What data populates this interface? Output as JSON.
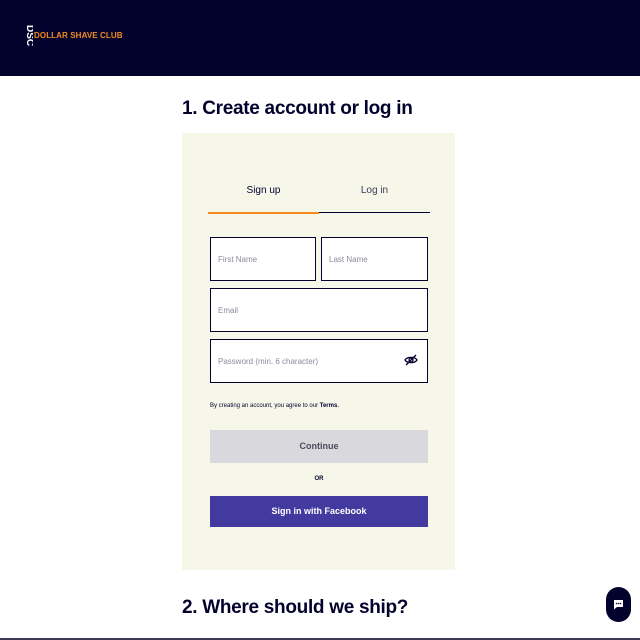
{
  "header": {
    "logo_mark": "DSC",
    "brand_name": "DOLLAR SHAVE CLUB"
  },
  "steps": {
    "step1_title": "1. Create account or log in",
    "step2_title": "2. Where should we ship?"
  },
  "tabs": {
    "signup_label": "Sign up",
    "login_label": "Log in",
    "active": "signup"
  },
  "form": {
    "first_name_placeholder": "First Name",
    "last_name_placeholder": "Last Name",
    "email_placeholder": "Email",
    "password_placeholder": "Password (min. 6 character)",
    "first_name_value": "",
    "last_name_value": "",
    "email_value": "",
    "password_value": ""
  },
  "terms": {
    "prefix": "By creating an account, you agree to our ",
    "link_label": "Terms",
    "suffix": "."
  },
  "buttons": {
    "continue_label": "Continue",
    "or_label": "OR",
    "facebook_label": "Sign in with Facebook"
  },
  "icons": {
    "password_toggle": "eye-off-icon",
    "chat": "chat-bubble-icon"
  },
  "colors": {
    "navy": "#03022d",
    "orange": "#f58a1f",
    "panel_bg": "#f6f6e9",
    "facebook": "#433aa0",
    "continue_disabled": "#d8d8dd"
  }
}
